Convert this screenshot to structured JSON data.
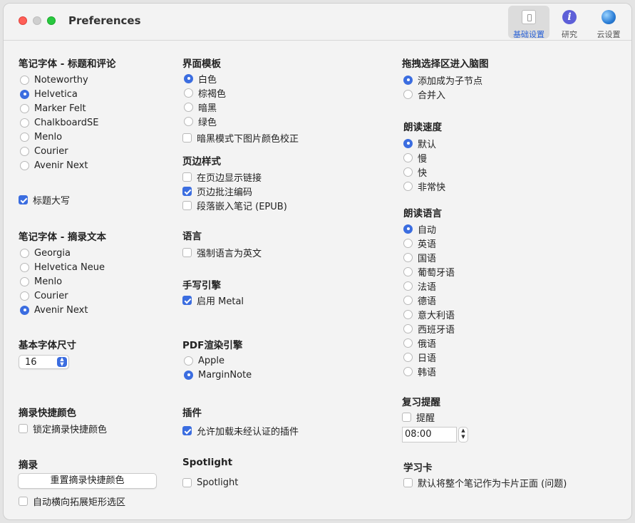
{
  "window": {
    "title": "Preferences"
  },
  "toolbar": {
    "tabs": [
      {
        "label": "基础设置",
        "icon": "settings-switch-icon",
        "active": true
      },
      {
        "label": "研究",
        "icon": "info-icon",
        "active": false
      },
      {
        "label": "云设置",
        "icon": "globe-icon",
        "active": false
      }
    ]
  },
  "note_font_title": {
    "heading": "笔记字体 - 标题和评论",
    "options": [
      "Noteworthy",
      "Helvetica",
      "Marker Felt",
      "ChalkboardSE",
      "Menlo",
      "Courier",
      "Avenir Next"
    ],
    "selected": "Helvetica"
  },
  "title_caps": {
    "label": "标题大写",
    "checked": true
  },
  "note_font_excerpt": {
    "heading": "笔记字体 - 摘录文本",
    "options": [
      "Georgia",
      "Helvetica Neue",
      "Menlo",
      "Courier",
      "Avenir Next"
    ],
    "selected": "Avenir Next"
  },
  "base_font_size": {
    "heading": "基本字体尺寸",
    "value": "16"
  },
  "excerpt_color": {
    "heading": "摘录快捷颜色",
    "lock_label": "锁定摘录快捷颜色",
    "lock_checked": false
  },
  "excerpt": {
    "heading": "摘录",
    "reset_button": "重置摘录快捷颜色",
    "auto_extend_label": "自动横向拓展矩形选区",
    "auto_extend_checked": false
  },
  "ui_theme": {
    "heading": "界面模板",
    "options": [
      "白色",
      "棕褐色",
      "暗黑",
      "绿色"
    ],
    "selected": "白色",
    "dark_image_label": "暗黑模式下图片颜色校正",
    "dark_image_checked": false
  },
  "margin_style": {
    "heading": "页边样式",
    "items": [
      {
        "label": "在页边显示链接",
        "checked": false
      },
      {
        "label": "页边批注编码",
        "checked": true
      },
      {
        "label": "段落嵌入笔记 (EPUB)",
        "checked": false
      }
    ]
  },
  "language": {
    "heading": "语言",
    "force_english_label": "强制语言为英文",
    "checked": false
  },
  "handwriting": {
    "heading": "手写引擎",
    "metal_label": "启用 Metal",
    "checked": true
  },
  "pdf_engine": {
    "heading": "PDF渲染引擎",
    "options": [
      "Apple",
      "MarginNote"
    ],
    "selected": "MarginNote"
  },
  "plugins": {
    "heading": "插件",
    "allow_label": "允许加载未经认证的插件",
    "checked": true
  },
  "spotlight": {
    "heading": "Spotlight",
    "label": "Spotlight",
    "checked": false
  },
  "drag_selection": {
    "heading": "拖拽选择区进入脑图",
    "options": [
      "添加成为子节点",
      "合并入"
    ],
    "selected": "添加成为子节点"
  },
  "read_speed": {
    "heading": "朗读速度",
    "options": [
      "默认",
      "慢",
      "快",
      "非常快"
    ],
    "selected": "默认"
  },
  "read_language": {
    "heading": "朗读语言",
    "options": [
      "自动",
      "英语",
      "国语",
      "葡萄牙语",
      "法语",
      "德语",
      "意大利语",
      "西班牙语",
      "俄语",
      "日语",
      "韩语"
    ],
    "selected": "自动"
  },
  "review": {
    "heading": "复习提醒",
    "remind_label": "提醒",
    "remind_checked": false,
    "time": "08:00"
  },
  "flashcard": {
    "heading": "学习卡",
    "default_front_label": "默认将整个笔记作为卡片正面 (问题)",
    "checked": false
  },
  "colors": {
    "accent": "#3b6de0"
  }
}
